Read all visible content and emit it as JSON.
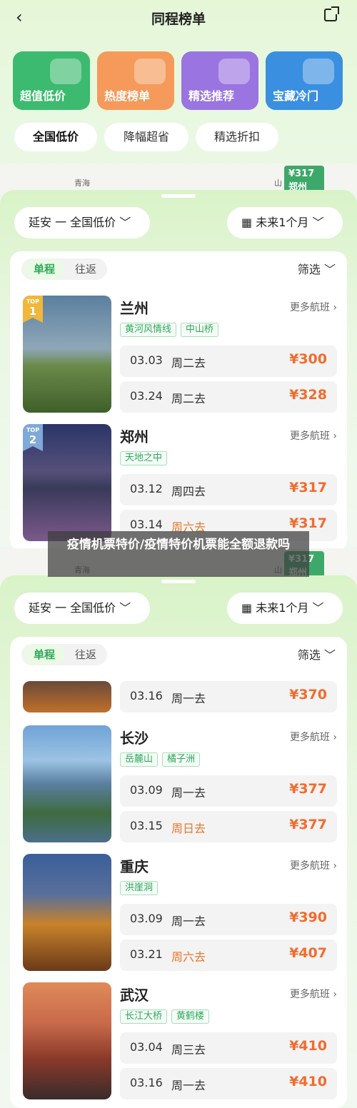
{
  "header": {
    "back_icon": "chevron-left-icon",
    "title": "同程榜单",
    "share_icon": "share-icon"
  },
  "categories": [
    {
      "label": "超值低价",
      "color": "#3cba6f"
    },
    {
      "label": "热度榜单",
      "color": "#f59a5a"
    },
    {
      "label": "精选推荐",
      "color": "#9a74e0"
    },
    {
      "label": "宝藏冷门",
      "color": "#3a8fe0"
    }
  ],
  "filters": [
    "全国低价",
    "降幅超省",
    "精选折扣"
  ],
  "map": {
    "label_left": "青海",
    "label_right": "山",
    "price": "¥317",
    "city": "郑州"
  },
  "selector": {
    "origin": "延安 一 全国低价",
    "date": "未来1个月"
  },
  "card": {
    "tab_oneway": "单程",
    "tab_return": "往返",
    "filter": "筛选",
    "more_label": "更多航班"
  },
  "cities_top": [
    {
      "name": "兰州",
      "rank_label": "TOP",
      "rank": "1",
      "tags": [
        "黄河风情线",
        "中山桥"
      ],
      "flights": [
        {
          "date": "03.03",
          "day": "周二去",
          "price": "¥300",
          "weekend": false
        },
        {
          "date": "03.24",
          "day": "周二去",
          "price": "¥328",
          "weekend": false
        }
      ],
      "color1": "#5b7f9e",
      "color2": "#6a8a4a",
      "badge": "#f0b73a"
    },
    {
      "name": "郑州",
      "rank_label": "TOP",
      "rank": "2",
      "tags": [
        "天地之中"
      ],
      "flights": [
        {
          "date": "03.12",
          "day": "周四去",
          "price": "¥317",
          "weekend": false
        },
        {
          "date": "03.14",
          "day": "周六去",
          "price": "¥317",
          "weekend": true
        }
      ],
      "color1": "#2b3566",
      "color2": "#7a5a8a",
      "badge": "#7fa9d9"
    }
  ],
  "overlay_text": "疫情机票特价/疫情特价机票能全额退款吗",
  "partial_flight": {
    "date": "03.16",
    "day": "周一去",
    "price": "¥370",
    "weekend": false
  },
  "cities_bottom": [
    {
      "name": "长沙",
      "tags": [
        "岳麓山",
        "橘子洲"
      ],
      "flights": [
        {
          "date": "03.09",
          "day": "周一去",
          "price": "¥377",
          "weekend": false
        },
        {
          "date": "03.15",
          "day": "周日去",
          "price": "¥377",
          "weekend": true
        }
      ],
      "color1": "#6fa3d6",
      "color2": "#3f6b3f"
    },
    {
      "name": "重庆",
      "tags": [
        "洪崖洞"
      ],
      "flights": [
        {
          "date": "03.09",
          "day": "周一去",
          "price": "¥390",
          "weekend": false
        },
        {
          "date": "03.21",
          "day": "周六去",
          "price": "¥407",
          "weekend": true
        }
      ],
      "color1": "#3a5f9a",
      "color2": "#c8822a"
    },
    {
      "name": "武汉",
      "tags": [
        "长江大桥",
        "黄鹤楼"
      ],
      "flights": [
        {
          "date": "03.04",
          "day": "周三去",
          "price": "¥410",
          "weekend": false
        },
        {
          "date": "03.16",
          "day": "周一去",
          "price": "¥410",
          "weekend": false
        }
      ],
      "color1": "#e08a5a",
      "color2": "#6a3a2a"
    }
  ]
}
